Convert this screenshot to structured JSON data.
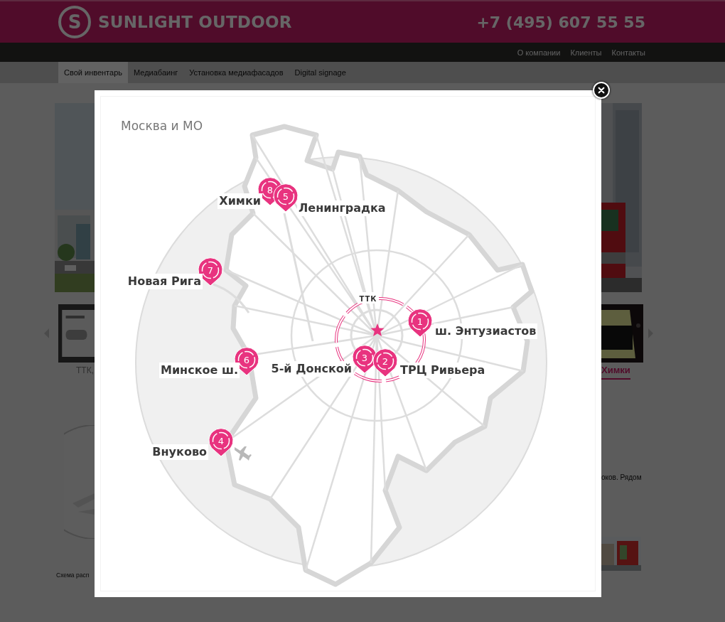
{
  "header": {
    "logo_letter": "S",
    "brand": "SUNLIGHT OUTDOOR",
    "phone": "+7 (495) 607 55 55"
  },
  "top_nav": [
    {
      "label": "О компании"
    },
    {
      "label": "Клиенты"
    },
    {
      "label": "Контакты"
    }
  ],
  "tabs": [
    {
      "label": "Свой инвентарь",
      "selected": true
    },
    {
      "label": "Медиабаинг",
      "selected": false
    },
    {
      "label": "Установка медиафасадов",
      "selected": false
    },
    {
      "label": "Digital signage",
      "selected": false
    }
  ],
  "background": {
    "left_caption": "ТТК,",
    "left_text": "Схема расп",
    "right_caption": "Химки",
    "right_text": "оков. Рядом"
  },
  "modal": {
    "title": "Москва и МО",
    "ring_label": "ТТК",
    "pins": [
      {
        "number": "8",
        "label": "Химки"
      },
      {
        "number": "5",
        "label": "Ленинградка"
      },
      {
        "number": "7",
        "label": "Новая Рига"
      },
      {
        "number": "1",
        "label": "ш. Энтузиастов"
      },
      {
        "number": "6",
        "label": "Минское ш."
      },
      {
        "number": "3",
        "label": "5-й Донской"
      },
      {
        "number": "2",
        "label": "ТРЦ Ривьера"
      },
      {
        "number": "4",
        "label": "Внуково"
      }
    ]
  }
}
